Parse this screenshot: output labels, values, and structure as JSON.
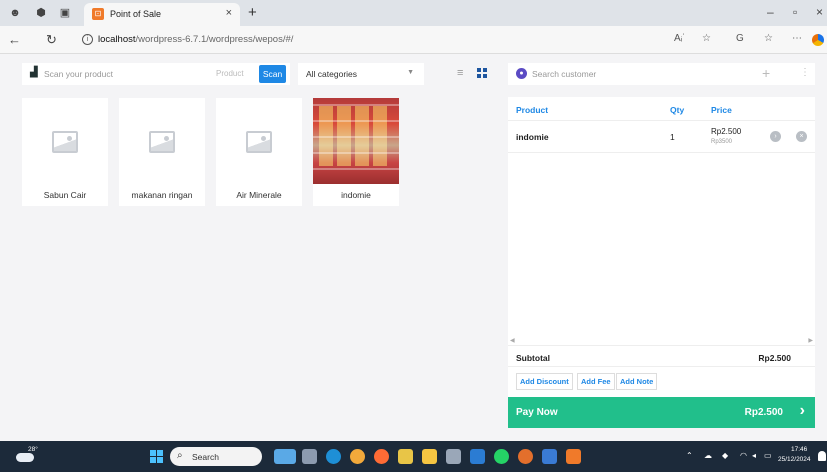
{
  "browser": {
    "tab_title": "Point of Sale",
    "url_host": "localhost",
    "url_path": "/wordpress-6.7.1/wordpress/wepos/#/",
    "read_aloud": "Aᵢ˙"
  },
  "toolbar": {
    "scan_placeholder": "Scan your product",
    "product_label": "Product",
    "scan_button": "Scan",
    "category_selected": "All categories"
  },
  "products": [
    {
      "name": "Sabun Cair",
      "has_image": false
    },
    {
      "name": "makanan ringan",
      "has_image": false
    },
    {
      "name": "Air Minerale",
      "has_image": false
    },
    {
      "name": "indomie",
      "has_image": true
    }
  ],
  "customer": {
    "placeholder": "Search customer"
  },
  "cart": {
    "headers": {
      "product": "Product",
      "qty": "Qty",
      "price": "Price"
    },
    "items": [
      {
        "name": "indomie",
        "qty": "1",
        "price": "Rp2.500",
        "regular_price": "Rp3500"
      }
    ],
    "subtotal_label": "Subtotal",
    "subtotal_value": "Rp2.500",
    "actions": {
      "discount": "Add Discount",
      "fee": "Add Fee",
      "note": "Add Note"
    },
    "pay_label": "Pay Now",
    "pay_total": "Rp2.500"
  },
  "taskbar": {
    "temperature": "28°",
    "search_label": "Search",
    "time": "17:46",
    "date": "25/12/2024"
  },
  "colors": {
    "accent": "#1e88e5",
    "pay": "#21bf8b",
    "taskbar": "#1c2a3a"
  }
}
